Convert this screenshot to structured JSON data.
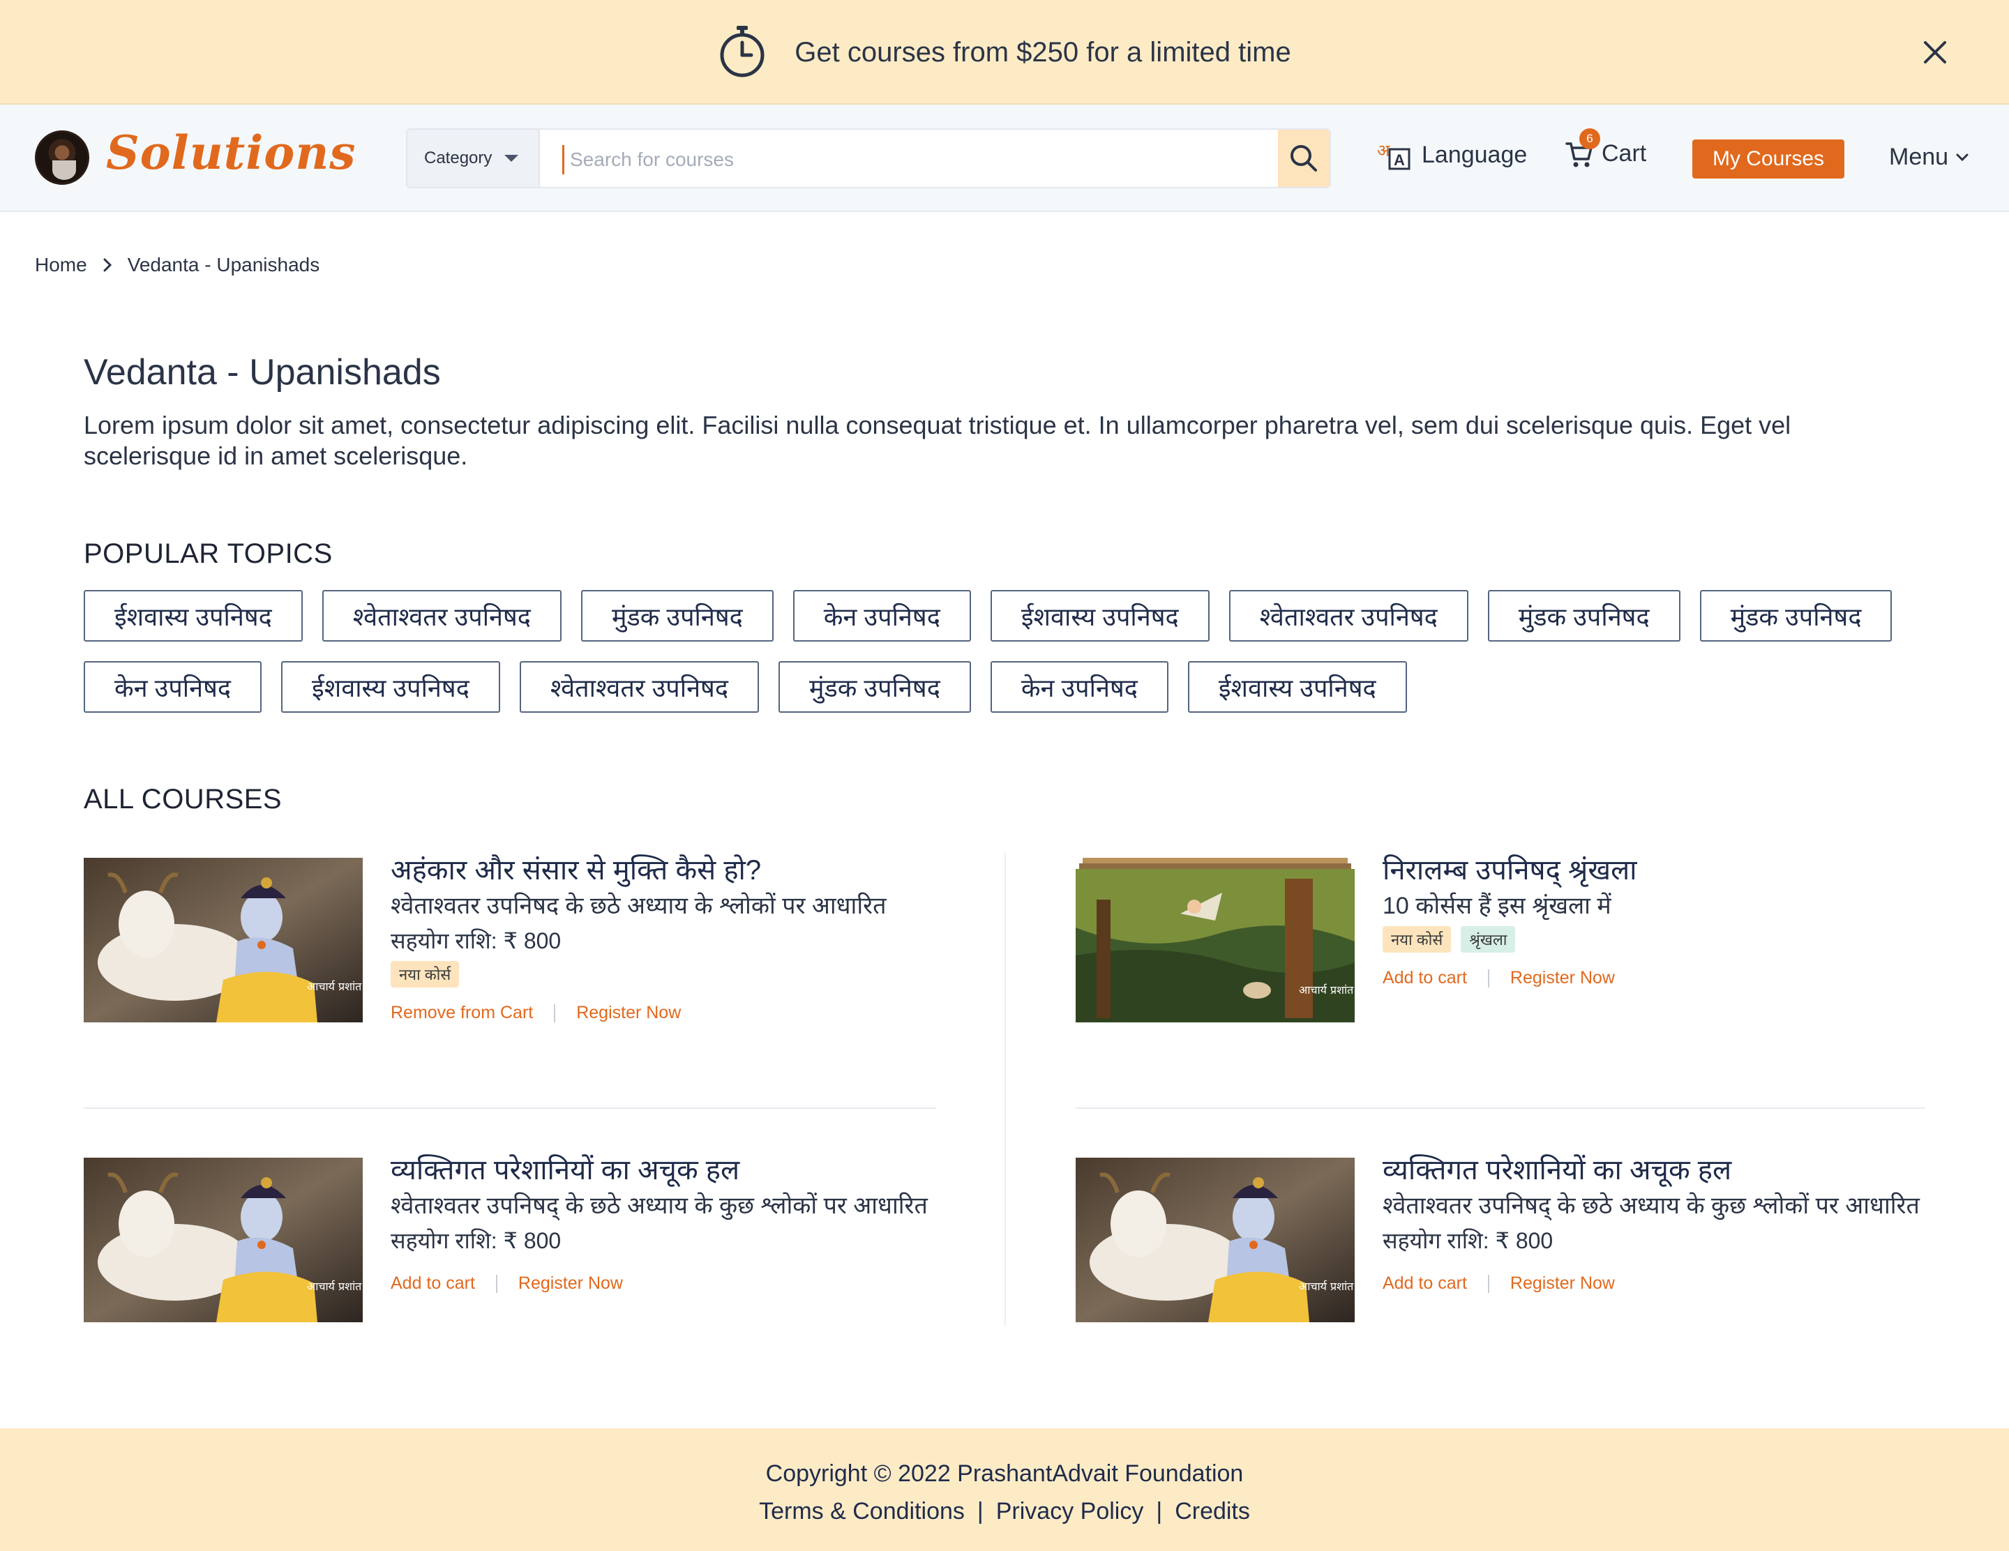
{
  "promo": {
    "text": "Get courses from $250 for a limited time",
    "icons": {
      "timer": "stopwatch-icon",
      "close": "close-icon"
    }
  },
  "header": {
    "logo": "Solutions",
    "search": {
      "category_label": "Category",
      "placeholder": "Search for courses"
    },
    "language_label": "Language",
    "cart_label": "Cart",
    "cart_count": "6",
    "my_courses_label": "My Courses",
    "menu_label": "Menu"
  },
  "breadcrumb": {
    "home": "Home",
    "current": "Vedanta - Upanishads"
  },
  "page": {
    "title": "Vedanta - Upanishads",
    "description": "Lorem ipsum dolor sit amet, consectetur adipiscing elit. Facilisi nulla consequat tristique et. In ullamcorper pharetra vel, sem dui scelerisque quis. Eget vel scelerisque id in amet scelerisque."
  },
  "popular_topics": {
    "heading": "POPULAR TOPICS",
    "items": [
      "ईशवास्य उपनिषद",
      "श्वेताश्वतर उपनिषद",
      "मुंडक उपनिषद",
      "केन उपनिषद",
      "ईशवास्य उपनिषद",
      "श्वेताश्वतर उपनिषद",
      "मुंडक उपनिषद",
      "मुंडक उपनिषद",
      "केन उपनिषद",
      "ईशवास्य उपनिषद",
      "श्वेताश्वतर उपनिषद",
      "मुंडक उपनिषद",
      "केन उपनिषद",
      "ईशवास्य उपनिषद"
    ]
  },
  "all_courses": {
    "heading": "ALL COURSES",
    "courses": [
      {
        "title": "अहंकार और संसार से मुक्ति कैसे हो?",
        "subtitle": "श्वेताश्वतर उपनिषद के छठे अध्याय के श्लोकों पर आधारित",
        "price": "सहयोग राशि: ₹ 800",
        "badges": [
          "नया कोर्स"
        ],
        "action_primary": "Remove from Cart",
        "action_secondary": "Register Now"
      },
      {
        "title": "निरालम्ब उपनिषद् श्रृंखला",
        "subtitle": "10 कोर्सस हैं इस श्रृंखला में",
        "badges": [
          "नया कोर्स",
          "श्रृंखला"
        ],
        "action_primary": "Add to cart",
        "action_secondary": "Register Now"
      },
      {
        "title": "व्यक्तिगत परेशानियों का अचूक हल",
        "subtitle": "श्वेताश्वतर उपनिषद् के छठे अध्याय के कुछ श्लोकों पर आधारित",
        "price": "सहयोग राशि: ₹ 800",
        "action_primary": "Add to cart",
        "action_secondary": "Register Now"
      },
      {
        "title": "व्यक्तिगत परेशानियों का अचूक हल",
        "subtitle": "श्वेताश्वतर उपनिषद् के छठे अध्याय के कुछ श्लोकों पर आधारित",
        "price": "सहयोग राशि: ₹ 800",
        "action_primary": "Add to cart",
        "action_secondary": "Register Now"
      }
    ],
    "thumb_watermark": "आचार्य प्रशांत"
  },
  "footer": {
    "copyright": "Copyright © 2022 PrashantAdvait Foundation",
    "links": [
      "Terms & Conditions",
      "Privacy Policy",
      "Credits"
    ],
    "separator": "|"
  },
  "colors": {
    "accent": "#e1691d",
    "banner_bg": "#fdebc6",
    "header_bg": "#f5f8fb",
    "text": "#2b3446"
  }
}
